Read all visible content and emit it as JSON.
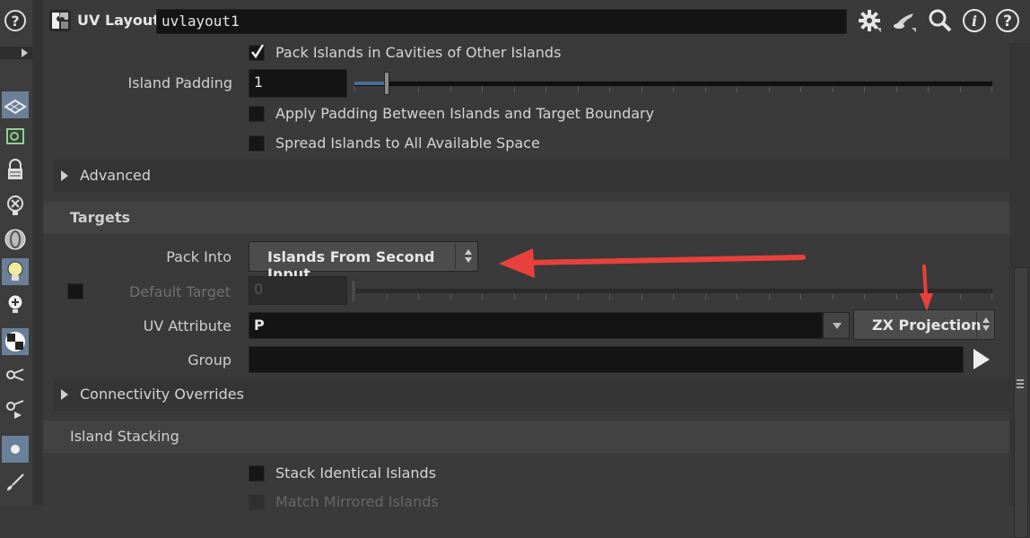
{
  "header": {
    "node_type": "UV Layout",
    "node_name": "uvlayout1",
    "icons": [
      "gear-icon",
      "brush-icon",
      "search-icon",
      "info-icon",
      "help-icon"
    ]
  },
  "toolbar": {
    "icons": [
      "help-icon",
      "expand-arrow-icon",
      "uv-flatten-icon",
      "uv-edit-icon",
      "lock-icon",
      "no-ghost-icon",
      "ghost-sphere-icon",
      "bulb-icon",
      "bulb-plus-icon",
      "checker-icon",
      "view-icon",
      "view-play-icon",
      "dot-icon",
      "brush-icon"
    ]
  },
  "params": {
    "pack_cavities_label": "Pack Islands in Cavities of Other Islands",
    "pack_cavities_checked": true,
    "island_padding_label": "Island Padding",
    "island_padding_value": "1",
    "island_padding_fraction": 0.05,
    "apply_padding_label": "Apply Padding Between Islands and Target Boundary",
    "spread_islands_label": "Spread Islands to All Available Space",
    "advanced_label": "Advanced"
  },
  "targets": {
    "title": "Targets",
    "pack_into_label": "Pack Into",
    "pack_into_value": "Islands From Second Input",
    "default_target_label": "Default Target",
    "default_target_value": "0",
    "uv_attribute_label": "UV Attribute",
    "uv_attribute_value": "P",
    "projection_value": "ZX Projection",
    "group_label": "Group",
    "group_value": "",
    "connectivity_label": "Connectivity Overrides"
  },
  "stacking": {
    "title": "Island Stacking",
    "stack_identical_label": "Stack Identical Islands",
    "match_mirrored_label": "Match Mirrored Islands"
  },
  "colors": {
    "accent": "#6a7f98",
    "annotation_arrow": "#e8413c"
  }
}
